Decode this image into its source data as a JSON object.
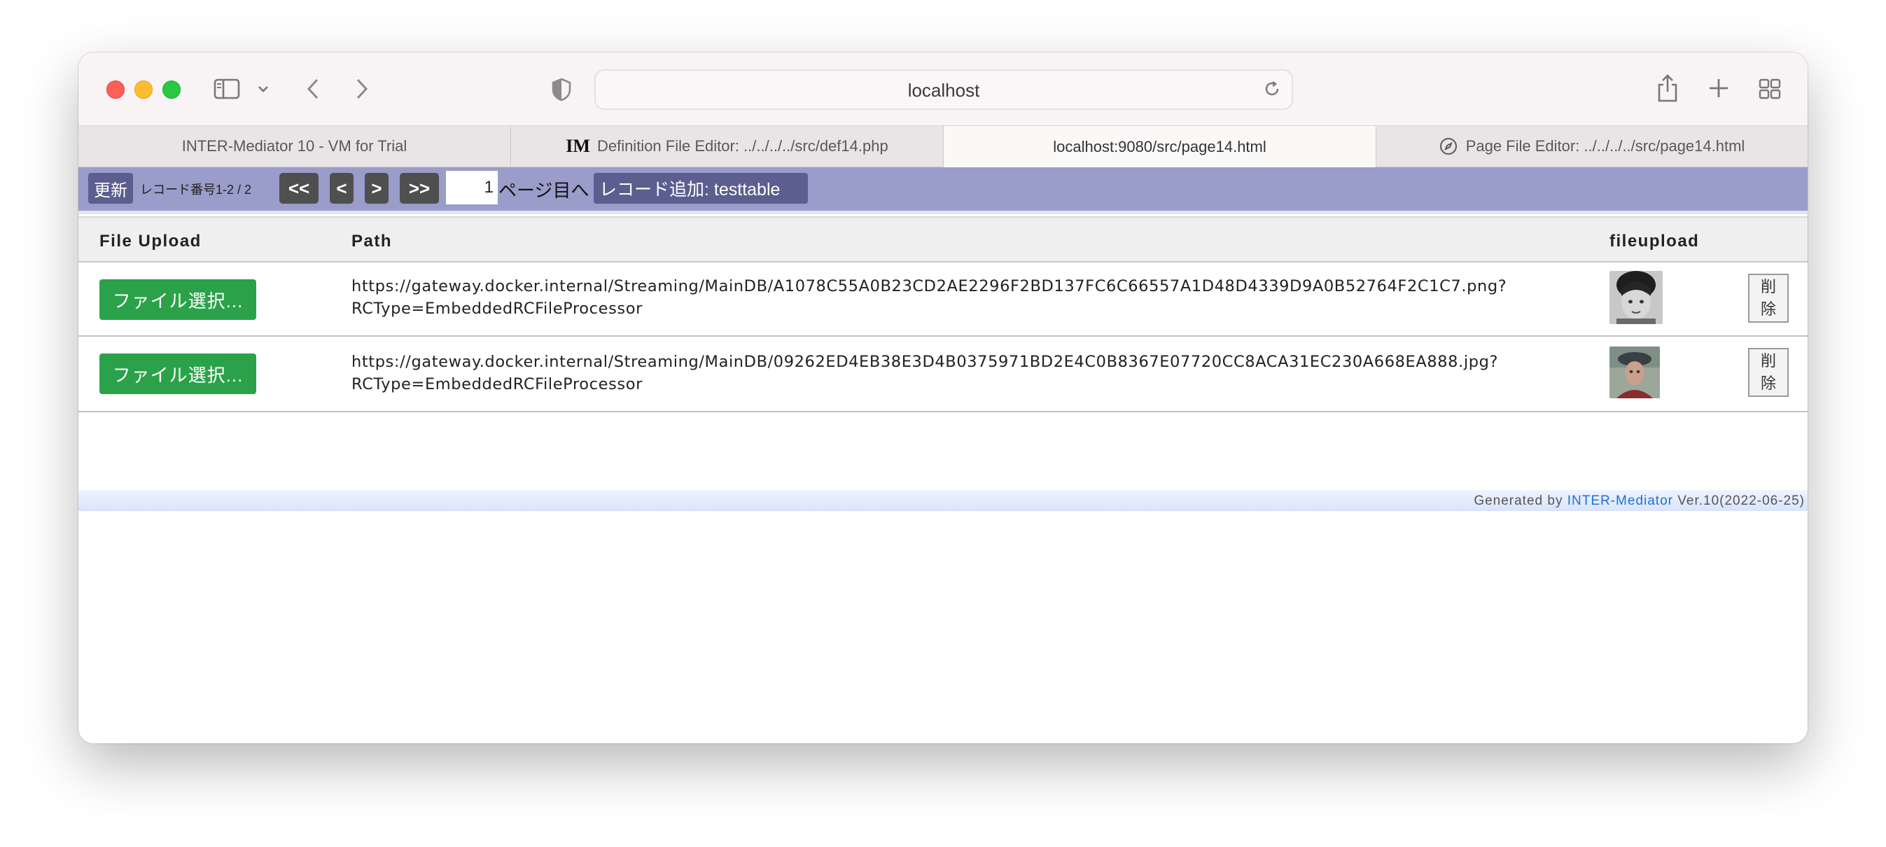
{
  "browser": {
    "address": "localhost",
    "tabs": [
      {
        "label": "INTER-Mediator 10 - VM for Trial"
      },
      {
        "label": "Definition File Editor: ../../../../src/def14.php"
      },
      {
        "label": "localhost:9080/src/page14.html"
      },
      {
        "label": "Page File Editor: ../../../../src/page14.html"
      }
    ]
  },
  "navbar": {
    "refresh_label": "更新",
    "record_info": "レコード番号1-2 / 2",
    "first_label": "<<",
    "prev_label": "<",
    "next_label": ">",
    "last_label": ">>",
    "page_value": "1",
    "page_suffix": "ページ目へ",
    "add_record_label": "レコード追加: testtable"
  },
  "table": {
    "headers": [
      "File Upload",
      "Path",
      "fileupload"
    ],
    "rows": [
      {
        "upload_label": "ファイル選択...",
        "path_line1": "https://gateway.docker.internal/Streaming/MainDB/A1078C55A0B23CD2AE2296F2BD137FC6C66557A1D48D4339D9A0B52764F2C1C7.png?",
        "path_line2": "RCType=EmbeddedRCFileProcessor",
        "delete_line1": "削",
        "delete_line2": "除"
      },
      {
        "upload_label": "ファイル選択...",
        "path_line1": "https://gateway.docker.internal/Streaming/MainDB/09262ED4EB38E3D4B0375971BD2E4C0B8367E07720CC8ACA31EC230A668EA888.jpg?",
        "path_line2": "RCType=EmbeddedRCFileProcessor",
        "delete_line1": "削",
        "delete_line2": "除"
      }
    ]
  },
  "footer": {
    "prefix": "Generated by ",
    "link": "INTER-Mediator",
    "suffix": " Ver.10(2022-06-25)"
  },
  "colors": {
    "navbar_bg": "#9a9cca",
    "upload_button": "#2ba24a",
    "link": "#1f6fd6"
  }
}
